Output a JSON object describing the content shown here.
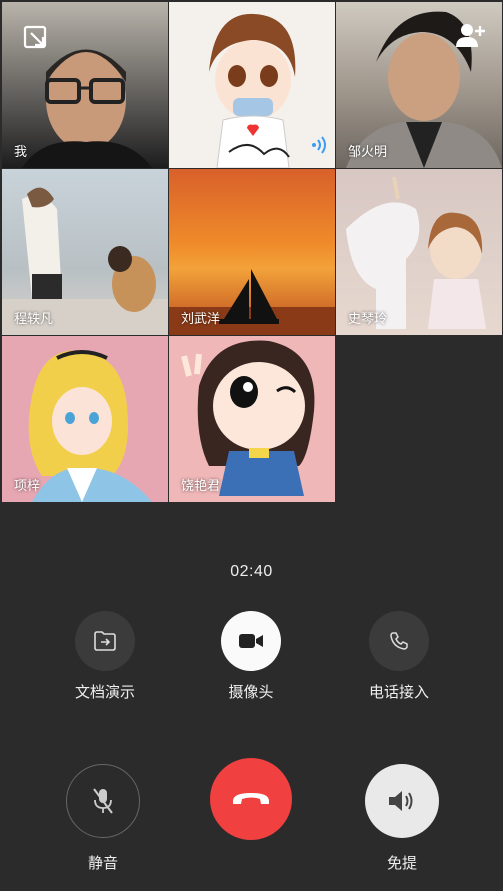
{
  "participants": [
    {
      "name": "我"
    },
    {
      "name": ""
    },
    {
      "name": "邹火明"
    },
    {
      "name": "程轶凡"
    },
    {
      "name": "刘武洋"
    },
    {
      "name": "史琴玲"
    },
    {
      "name": "项梓"
    },
    {
      "name": "饶艳君"
    }
  ],
  "call": {
    "duration": "02:40"
  },
  "actions": {
    "doc_label": "文档演示",
    "camera_label": "摄像头",
    "phone_label": "电话接入",
    "mute_label": "静音",
    "speaker_label": "免提"
  },
  "colors": {
    "hangup": "#f04040",
    "background": "#2b2b2b"
  },
  "icons": [
    "minimize-icon",
    "add-user-icon",
    "speaking-icon",
    "file-share-icon",
    "camera-icon",
    "phone-icon",
    "mic-off-icon",
    "hangup-icon",
    "speaker-icon"
  ]
}
